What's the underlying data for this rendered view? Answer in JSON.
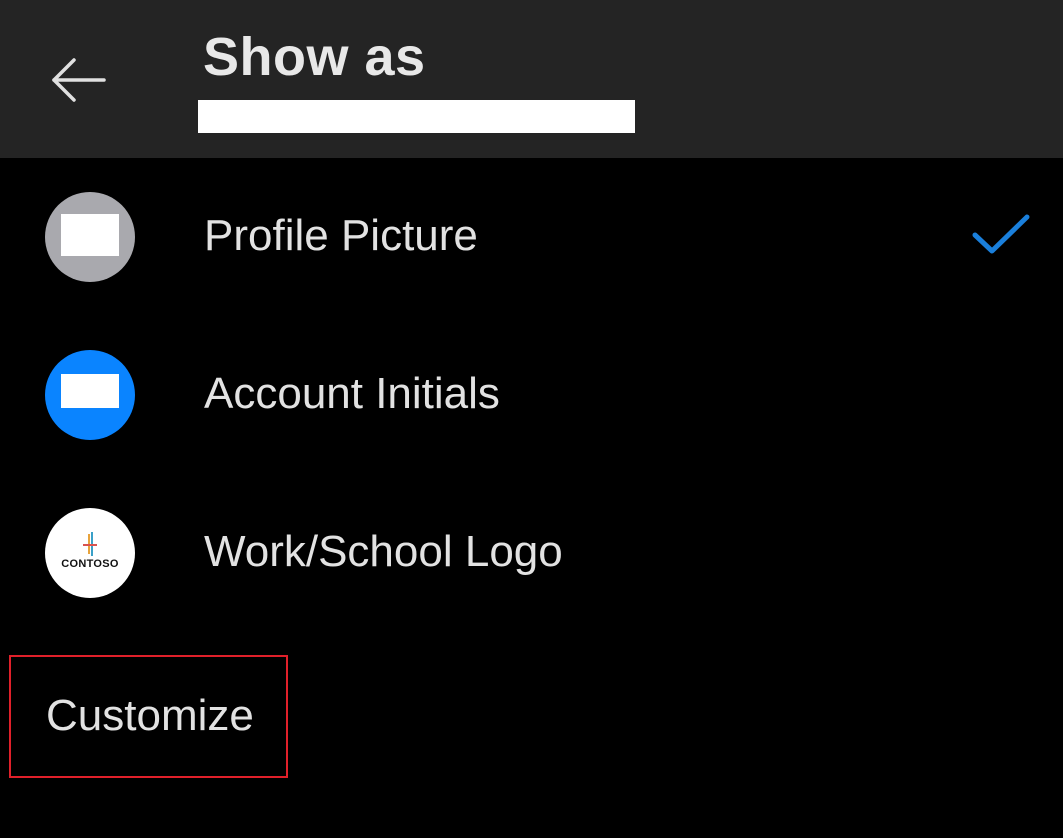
{
  "header": {
    "title": "Show as",
    "back_icon": "arrow-left-icon"
  },
  "options": [
    {
      "label": "Profile Picture",
      "icon": "profile-picture-avatar",
      "selected": true
    },
    {
      "label": "Account Initials",
      "icon": "account-initials-avatar",
      "selected": false
    },
    {
      "label": "Work/School Logo",
      "icon": "contoso-logo",
      "logo_text": "CONTOSO",
      "selected": false
    }
  ],
  "customize": {
    "label": "Customize"
  },
  "colors": {
    "background": "#000000",
    "header_background": "#242424",
    "accent_blue": "#0a84ff",
    "check_color": "#1a7fdb",
    "highlight_red": "#e0202a",
    "profile_avatar_grey": "#a9a9ae"
  }
}
